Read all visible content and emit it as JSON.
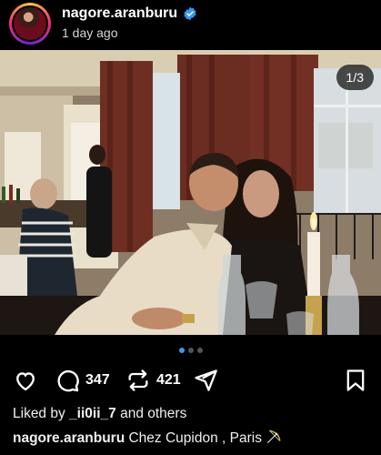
{
  "post": {
    "username": "nagore.aranburu",
    "timestamp": "1 day ago",
    "image_counter": "1/3",
    "comments_count": "347",
    "reposts_count": "421",
    "liked_by_prefix": "Liked by",
    "liked_by_user": "_ii0ii_7",
    "liked_by_suffix": "and others",
    "caption_user": "nagore.aranburu",
    "caption_text": "Chez Cupidon , Paris",
    "carousel": {
      "total": 3,
      "current": 1
    }
  },
  "colors": {
    "background": "#000000",
    "verified": "#3897f0",
    "active_dot": "#3897f0"
  },
  "icons": {
    "like": "heart-icon",
    "comment": "comment-icon",
    "repost": "repost-icon",
    "share": "send-icon",
    "save": "bookmark-icon",
    "verified": "verified-badge-icon",
    "caption_emoji": "bow-and-arrow-icon"
  }
}
